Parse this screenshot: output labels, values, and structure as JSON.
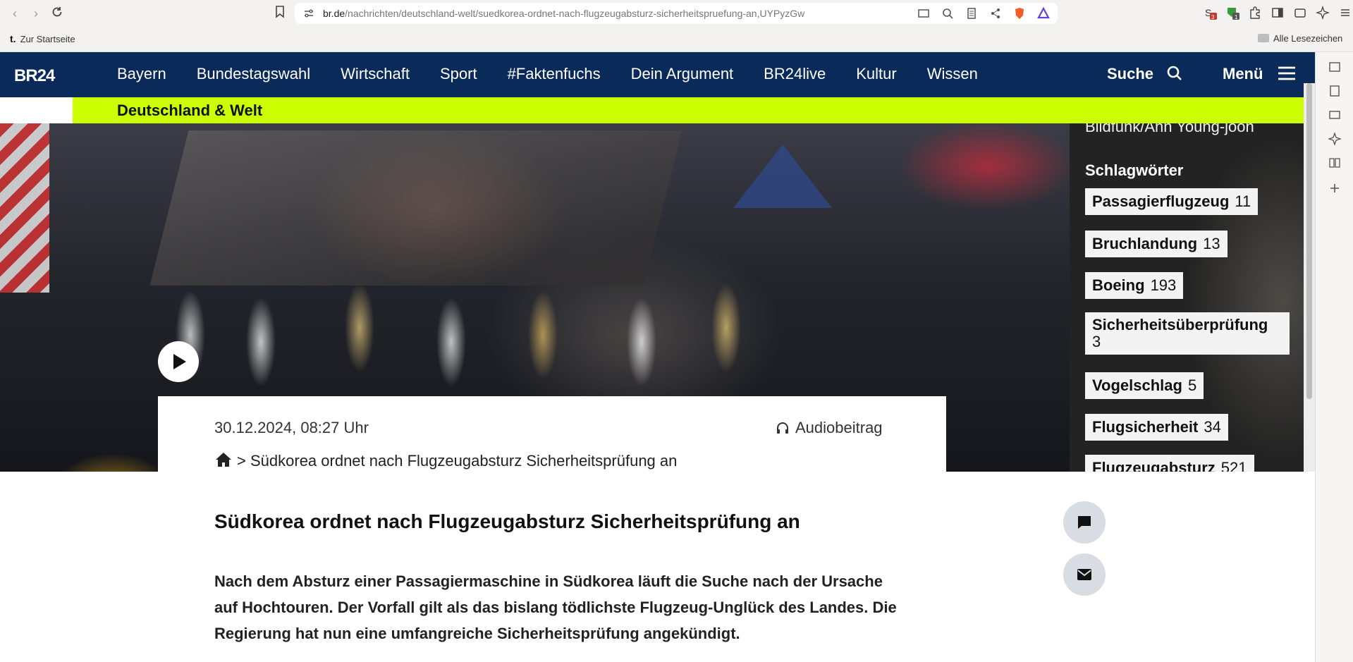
{
  "browser": {
    "url_domain": "br.de",
    "url_path": "/nachrichten/deutschland-welt/suedkorea-ordnet-nach-flugzeugabsturz-sicherheitspruefung-an,UYPyzGw",
    "bookmark_home": "Zur Startseite",
    "bookmarks_all": "Alle Lesezeichen",
    "ext_badge_1": "3",
    "ext_badge_2": "1"
  },
  "site": {
    "logo": "BR24",
    "nav": [
      "Bayern",
      "Bundestagswahl",
      "Wirtschaft",
      "Sport",
      "#Faktenfuchs",
      "Dein Argument",
      "BR24live",
      "Kultur",
      "Wissen"
    ],
    "search_label": "Suche",
    "menu_label": "Menü",
    "section": "Deutschland & Welt"
  },
  "article": {
    "date": "30.12.2024, 08:27 Uhr",
    "audio_label": "Audiobeitrag",
    "breadcrumb_sep": ">",
    "breadcrumb_title": "Südkorea ordnet nach Flugzeugabsturz Sicherheitsprüfung an",
    "headline": "Südkorea ordnet nach Flugzeugabsturz Sicherheitsprüfung an",
    "lead": "Nach dem Absturz einer Passagiermaschine in Südkorea läuft die Suche nach der Ursache auf Hochtouren. Der Vorfall gilt als das bislang tödlichste Flugzeug-Unglück des Landes. Die Regierung hat nun eine umfangreiche Sicherheitsprüfung angekündigt."
  },
  "sidebar": {
    "credit": "Bildfunk/Ahn Young-joon",
    "keywords_title": "Schlagwörter",
    "tags": [
      {
        "label": "Passagierflugzeug",
        "count": "11"
      },
      {
        "label": "Bruchlandung",
        "count": "13"
      },
      {
        "label": "Boeing",
        "count": "193"
      },
      {
        "label": "Sicherheitsüberprüfung",
        "count": "3"
      },
      {
        "label": "Vogelschlag",
        "count": "5"
      },
      {
        "label": "Flugsicherheit",
        "count": "34"
      },
      {
        "label": "Flugzeugabsturz",
        "count": "521"
      }
    ]
  },
  "colors": {
    "header_bg": "#0a2a5a",
    "section_bar": "#ccff00"
  }
}
